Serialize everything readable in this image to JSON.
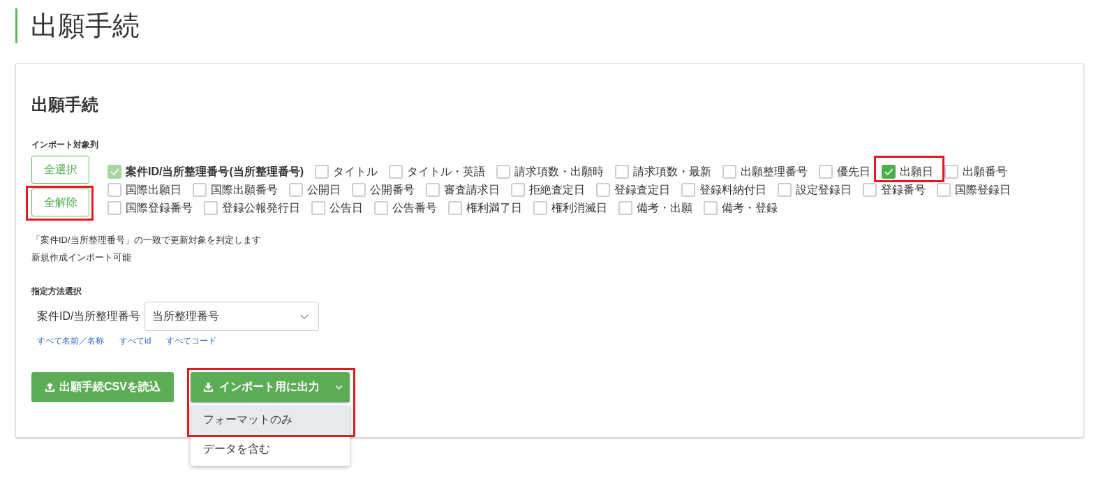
{
  "page": {
    "title": "出願手続"
  },
  "card": {
    "title": "出願手続",
    "import_columns": {
      "label": "インポート対象列",
      "buttons": [
        {
          "label": "全選択",
          "highlighted": false
        },
        {
          "label": "全解除",
          "highlighted": true
        }
      ],
      "columns": [
        {
          "label": "案件ID/当所整理番号(当所整理番号)",
          "checked": true,
          "disabled": true,
          "highlighted": false
        },
        {
          "label": "タイトル",
          "checked": false,
          "disabled": false,
          "highlighted": false
        },
        {
          "label": "タイトル・英語",
          "checked": false,
          "disabled": false,
          "highlighted": false
        },
        {
          "label": "請求項数・出願時",
          "checked": false,
          "disabled": false,
          "highlighted": false
        },
        {
          "label": "請求項数・最新",
          "checked": false,
          "disabled": false,
          "highlighted": false
        },
        {
          "label": "出願整理番号",
          "checked": false,
          "disabled": false,
          "highlighted": false
        },
        {
          "label": "優先日",
          "checked": false,
          "disabled": false,
          "highlighted": false
        },
        {
          "label": "出願日",
          "checked": true,
          "disabled": false,
          "highlighted": true
        },
        {
          "label": "出願番号",
          "checked": false,
          "disabled": false,
          "highlighted": false
        },
        {
          "label": "国際出願日",
          "checked": false,
          "disabled": false,
          "highlighted": false
        },
        {
          "label": "国際出願番号",
          "checked": false,
          "disabled": false,
          "highlighted": false
        },
        {
          "label": "公開日",
          "checked": false,
          "disabled": false,
          "highlighted": false
        },
        {
          "label": "公開番号",
          "checked": false,
          "disabled": false,
          "highlighted": false
        },
        {
          "label": "審査請求日",
          "checked": false,
          "disabled": false,
          "highlighted": false
        },
        {
          "label": "拒絶査定日",
          "checked": false,
          "disabled": false,
          "highlighted": false
        },
        {
          "label": "登録査定日",
          "checked": false,
          "disabled": false,
          "highlighted": false
        },
        {
          "label": "登録料納付日",
          "checked": false,
          "disabled": false,
          "highlighted": false
        },
        {
          "label": "設定登録日",
          "checked": false,
          "disabled": false,
          "highlighted": false
        },
        {
          "label": "登録番号",
          "checked": false,
          "disabled": false,
          "highlighted": false
        },
        {
          "label": "国際登録日",
          "checked": false,
          "disabled": false,
          "highlighted": false
        },
        {
          "label": "国際登録番号",
          "checked": false,
          "disabled": false,
          "highlighted": false
        },
        {
          "label": "登録公報発行日",
          "checked": false,
          "disabled": false,
          "highlighted": false
        },
        {
          "label": "公告日",
          "checked": false,
          "disabled": false,
          "highlighted": false
        },
        {
          "label": "公告番号",
          "checked": false,
          "disabled": false,
          "highlighted": false
        },
        {
          "label": "権利満了日",
          "checked": false,
          "disabled": false,
          "highlighted": false
        },
        {
          "label": "権利消滅日",
          "checked": false,
          "disabled": false,
          "highlighted": false
        },
        {
          "label": "備考・出願",
          "checked": false,
          "disabled": false,
          "highlighted": false
        },
        {
          "label": "備考・登録",
          "checked": false,
          "disabled": false,
          "highlighted": false
        }
      ]
    },
    "notes": [
      "「案件ID/当所整理番号」の一致で更新対象を判定します",
      "新規作成インポート可能"
    ],
    "method": {
      "label": "指定方法選択",
      "field_label": "案件ID/当所整理番号",
      "select": {
        "value": "当所整理番号"
      },
      "links": [
        "すべて名前／名称",
        "すべてid",
        "すべてコード"
      ]
    },
    "actions": {
      "load_button": {
        "label": "出願手続CSVを読込"
      },
      "export_button": {
        "label": "インポート用に出力",
        "expanded": true,
        "highlighted": true
      },
      "menu": [
        {
          "label": "フォーマットのみ",
          "selected": true
        },
        {
          "label": "データを含む",
          "selected": false
        }
      ]
    }
  }
}
